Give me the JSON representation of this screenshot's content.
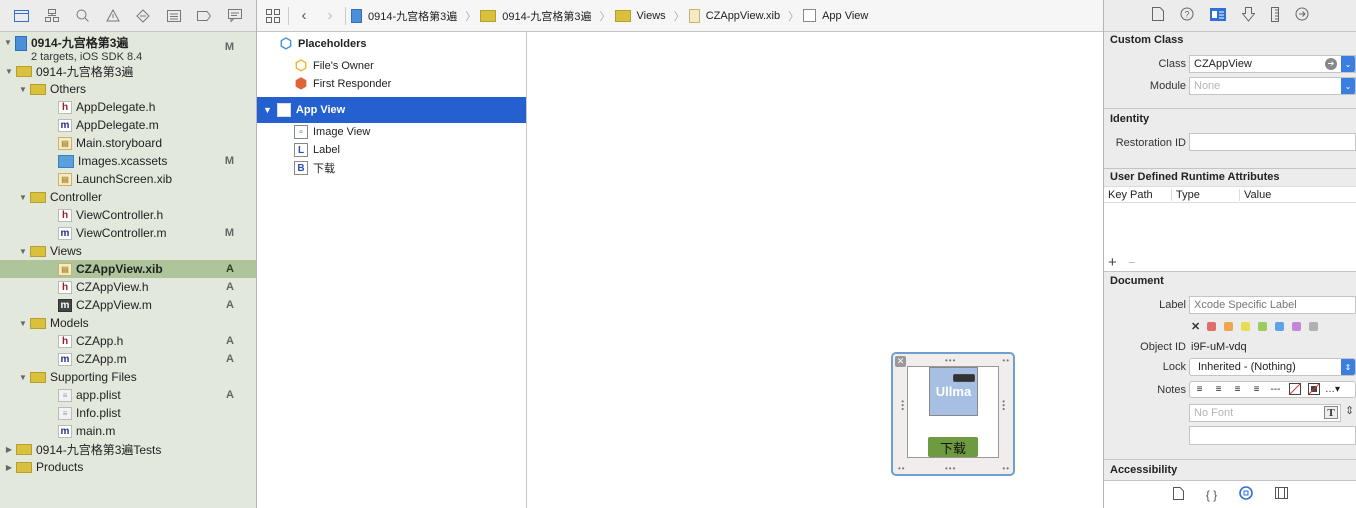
{
  "navigator": {
    "toolbar_icons": [
      "folder-icon",
      "hierarchy-icon",
      "search-icon",
      "warning-icon",
      "test-diamond-icon",
      "list-icon",
      "breakpoint-icon",
      "message-icon"
    ],
    "project": {
      "name": "0914-九宫格第3遍",
      "subtitle": "2 targets, iOS SDK 8.4",
      "status": "M"
    },
    "items": [
      {
        "label": "0914-九宫格第3遍",
        "type": "folder",
        "level": 1,
        "expanded": true,
        "status": ""
      },
      {
        "label": "Others",
        "type": "folder",
        "level": 2,
        "expanded": true,
        "status": ""
      },
      {
        "label": "AppDelegate.h",
        "type": "h",
        "level": 3,
        "status": ""
      },
      {
        "label": "AppDelegate.m",
        "type": "m",
        "level": 3,
        "status": ""
      },
      {
        "label": "Main.storyboard",
        "type": "xib",
        "level": 3,
        "status": ""
      },
      {
        "label": "Images.xcassets",
        "type": "assets",
        "level": 3,
        "status": "M"
      },
      {
        "label": "LaunchScreen.xib",
        "type": "xib",
        "level": 3,
        "status": ""
      },
      {
        "label": "Controller",
        "type": "folder",
        "level": 2,
        "expanded": true,
        "status": ""
      },
      {
        "label": "ViewController.h",
        "type": "h",
        "level": 3,
        "status": ""
      },
      {
        "label": "ViewController.m",
        "type": "m",
        "level": 3,
        "status": "M"
      },
      {
        "label": "Views",
        "type": "folder",
        "level": 2,
        "expanded": true,
        "status": ""
      },
      {
        "label": "CZAppView.xib",
        "type": "xib",
        "level": 3,
        "status": "A",
        "selected": true
      },
      {
        "label": "CZAppView.h",
        "type": "h",
        "level": 3,
        "status": "A"
      },
      {
        "label": "CZAppView.m",
        "type": "mdark",
        "level": 3,
        "status": "A"
      },
      {
        "label": "Models",
        "type": "folder",
        "level": 2,
        "expanded": true,
        "status": ""
      },
      {
        "label": "CZApp.h",
        "type": "h",
        "level": 3,
        "status": "A"
      },
      {
        "label": "CZApp.m",
        "type": "m",
        "level": 3,
        "status": "A"
      },
      {
        "label": "Supporting Files",
        "type": "folder",
        "level": 2,
        "expanded": true,
        "status": ""
      },
      {
        "label": "app.plist",
        "type": "plist",
        "level": 3,
        "status": "A"
      },
      {
        "label": "Info.plist",
        "type": "plist",
        "level": 3,
        "status": ""
      },
      {
        "label": "main.m",
        "type": "m",
        "level": 3,
        "status": ""
      },
      {
        "label": "0914-九宫格第3遍Tests",
        "type": "folder",
        "level": 1,
        "expanded": false,
        "status": ""
      },
      {
        "label": "Products",
        "type": "folder",
        "level": 1,
        "expanded": false,
        "status": ""
      }
    ]
  },
  "jumpbar": {
    "crumbs": [
      {
        "label": "0914-九宫格第3遍",
        "icon": "proj"
      },
      {
        "label": "0914-九宫格第3遍",
        "icon": "folder"
      },
      {
        "label": "Views",
        "icon": "folder"
      },
      {
        "label": "CZAppView.xib",
        "icon": "xib"
      },
      {
        "label": "App View",
        "icon": "view"
      }
    ]
  },
  "outline": {
    "placeholders_label": "Placeholders",
    "files_owner": "File's Owner",
    "first_responder": "First Responder",
    "app_view": "App View",
    "children": [
      {
        "label": "Image View",
        "icon": "image"
      },
      {
        "label": "Label",
        "icon": "L"
      },
      {
        "label": "下载",
        "icon": "B"
      }
    ]
  },
  "canvas": {
    "image_text": "Ullma",
    "button_text": "下载"
  },
  "inspector": {
    "tabs": [
      "file-icon",
      "quick-help-icon",
      "identity-icon",
      "attributes-icon",
      "size-icon",
      "connections-icon"
    ],
    "custom_class": {
      "title": "Custom Class",
      "class_label": "Class",
      "class_value": "CZAppView",
      "module_label": "Module",
      "module_placeholder": "None"
    },
    "identity": {
      "title": "Identity",
      "restoration_label": "Restoration ID",
      "restoration_value": ""
    },
    "udra": {
      "title": "User Defined Runtime Attributes",
      "columns": [
        "Key Path",
        "Type",
        "Value"
      ],
      "add": "+",
      "remove": "−"
    },
    "document": {
      "title": "Document",
      "label_label": "Label",
      "label_placeholder": "Xcode Specific Label",
      "colors": [
        "#e06b6b",
        "#efa64c",
        "#e8dd50",
        "#9ccc5c",
        "#5ea3e6",
        "#c586d8",
        "#b0b0b0"
      ],
      "object_id_label": "Object ID",
      "object_id_value": "i9F-uM-vdq",
      "lock_label": "Lock",
      "lock_value": "Inherited - (Nothing)",
      "notes_label": "Notes",
      "font_placeholder": "No Font"
    },
    "accessibility": {
      "title": "Accessibility"
    },
    "library_tabs": [
      "file-template-icon",
      "code-snippet-icon",
      "object-library-icon",
      "media-library-icon"
    ]
  }
}
